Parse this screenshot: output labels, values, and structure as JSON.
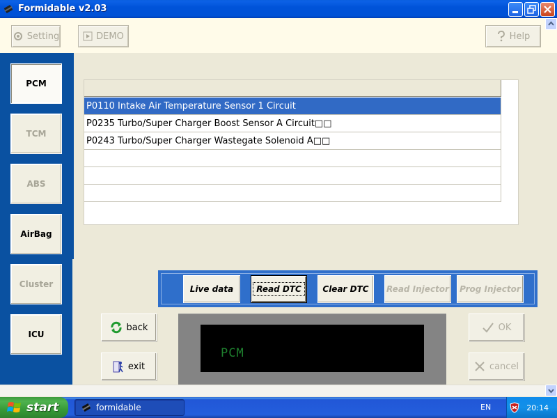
{
  "window": {
    "title": "Formidable v2.03"
  },
  "toolbar": {
    "setting_label": "Setting",
    "demo_label": "DEMO",
    "help_label": "Help"
  },
  "nav": {
    "items": [
      {
        "label": "PCM",
        "state": "selected"
      },
      {
        "label": "TCM",
        "state": "disabled"
      },
      {
        "label": "ABS",
        "state": "disabled"
      },
      {
        "label": "AirBag",
        "state": "enabled"
      },
      {
        "label": "Cluster",
        "state": "disabled"
      },
      {
        "label": "ICU",
        "state": "enabled"
      }
    ]
  },
  "dtc_list": {
    "rows": [
      "P0110 Intake Air Temperature Sensor 1 Circuit",
      "P0235 Turbo/Super Charger Boost Sensor A Circuit□□",
      "P0243 Turbo/Super Charger Wastegate Solenoid A□□",
      "",
      "",
      ""
    ],
    "selected_index": 0
  },
  "functions": {
    "live_data": "Live data",
    "read_dtc": "Read DTC",
    "clear_dtc": "Clear DTC",
    "read_injector": "Read Injector",
    "prog_injector": "Prog Injector"
  },
  "controls": {
    "back_label": "back",
    "exit_label": "exit",
    "ok_label": "OK",
    "cancel_label": "cancel"
  },
  "display": {
    "text": "PCM",
    "color": "#1E7F2E"
  },
  "taskbar": {
    "start_label": "start",
    "task_label": "formidable",
    "lang": "EN",
    "clock": "20:14"
  },
  "colors": {
    "titlebar": "#0053D9",
    "panel": "#0A51A1",
    "selection": "#316AC5",
    "funcbar": "#2F6FCB"
  }
}
